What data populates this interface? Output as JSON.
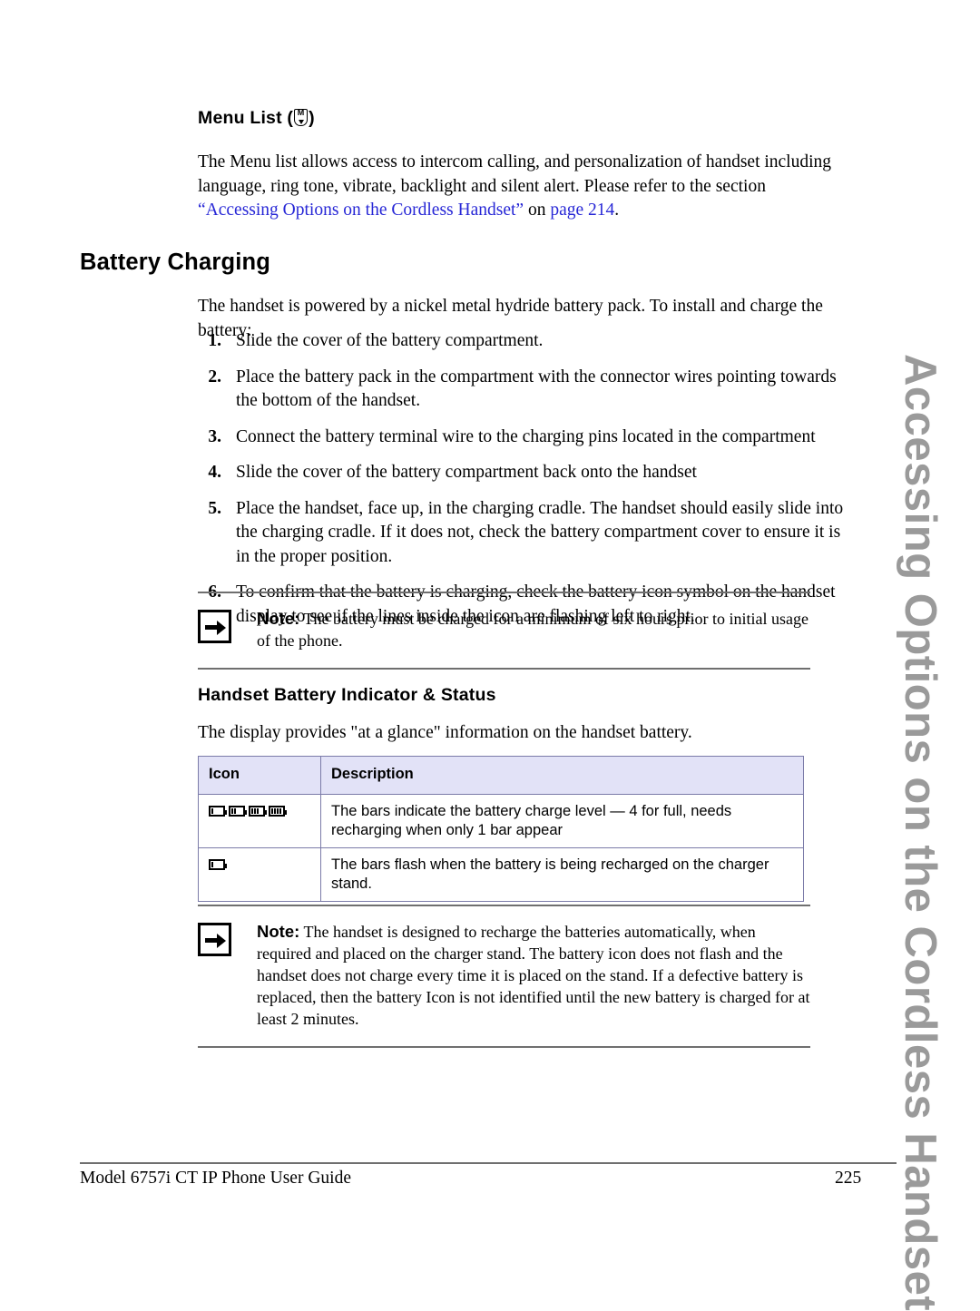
{
  "side_tab": {
    "text": "Accessing Options on the Cordless Handset"
  },
  "menu_list": {
    "heading_prefix": "Menu List (",
    "heading_suffix": ")",
    "icon_name": "menu-glyph-icon",
    "icon_letter": "M",
    "paragraph_part1": "The Menu list allows access to intercom calling, and personalization of handset including language, ring tone, vibrate, backlight and silent alert. Please refer to the section ",
    "xref_open_quote": "“Accessing Options on the Cordless Handset”",
    "paragraph_part2": " on ",
    "page_ref": "page 214",
    "paragraph_end": "."
  },
  "battery_charging": {
    "heading": "Battery Charging",
    "intro": "The handset is powered by a nickel metal hydride battery pack. To install and charge the battery:",
    "steps": [
      {
        "num": "1.",
        "text": "Slide the cover of the battery compartment."
      },
      {
        "num": "2.",
        "text": "Place the battery pack in the compartment with the connector wires pointing towards the bottom of the handset."
      },
      {
        "num": "3.",
        "text": "Connect the battery terminal wire to the charging pins located in the compartment"
      },
      {
        "num": "4.",
        "text": "Slide the cover of the battery compartment back onto the handset"
      },
      {
        "num": "5.",
        "text": "Place the handset, face up, in the charging cradle. The handset should easily slide into the charging cradle. If it does not, check the battery compartment cover to ensure it is in the proper position."
      },
      {
        "num": "6.",
        "text": "To confirm that the battery is charging, check the battery icon symbol on the handset display to see if the lines inside the icon are flashing left to right."
      }
    ]
  },
  "note_one": {
    "label": "Note:",
    "text": "The battery must be charged for a minimum of six hours prior to initial usage of the phone.",
    "icon_name": "note-arrow-icon"
  },
  "indicator_section": {
    "heading": "Handset Battery Indicator & Status",
    "intro": "The display provides \"at a glance\" information on the handset battery.",
    "table": {
      "headers": [
        "Icon",
        "Description"
      ],
      "rows": [
        {
          "icon_name": "battery-level-icons",
          "icon_bars": [
            1,
            2,
            3,
            4
          ],
          "description": "The bars indicate the battery charge level — 4 for full, needs recharging when only 1 bar appear"
        },
        {
          "icon_name": "battery-charging-icon",
          "icon_bars": [
            1
          ],
          "description": "The bars flash when the battery is being recharged on the charger stand."
        }
      ]
    }
  },
  "note_two": {
    "label": "Note:",
    "text": "The handset is designed to recharge the batteries automatically, when required and placed on the charger stand. The battery icon does not flash and the handset does not charge every time it is placed on the stand. If a defective battery is replaced, then the battery Icon is not identified until the new battery is charged for at least 2 minutes.",
    "icon_name": "note-arrow-icon"
  },
  "footer": {
    "left": "Model 6757i CT IP Phone User Guide",
    "right": "225"
  },
  "colors": {
    "xref_blue": "#2727d6",
    "table_header_bg": "#e2e2f7",
    "table_border": "#7b7ba8",
    "side_tab_gray": "#9a9a9a",
    "rule_gray": "#6f6f6f"
  }
}
